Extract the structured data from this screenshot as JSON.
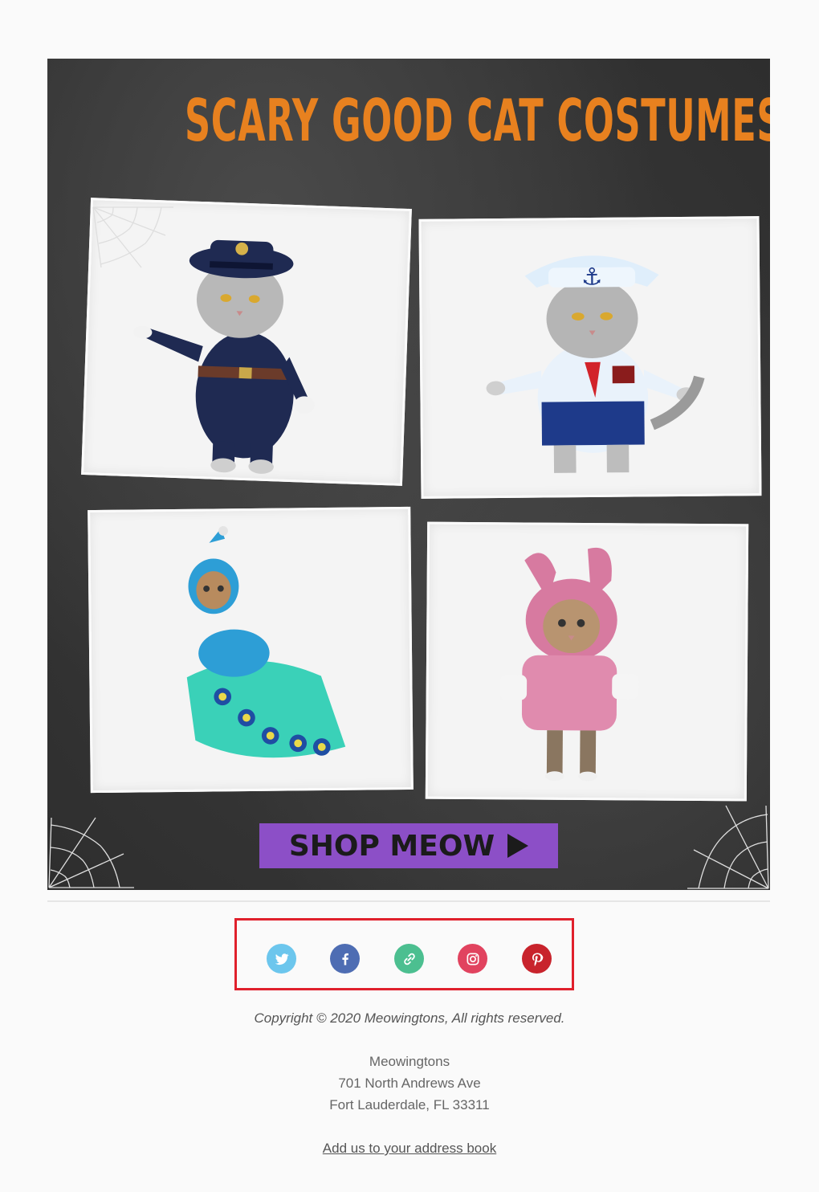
{
  "hero": {
    "title": "SCARY GOOD CAT COSTUMES",
    "shop_button": "SHOP MEOW",
    "colors": {
      "title": "#e8811f",
      "button": "#8c4fc7",
      "background": "#333333"
    },
    "photos": [
      "police-cat",
      "sailor-cat",
      "peacock-cat",
      "bunny-cat"
    ]
  },
  "social": {
    "icons": [
      "twitter-icon",
      "facebook-icon",
      "link-icon",
      "instagram-icon",
      "pinterest-icon"
    ],
    "colors": {
      "twitter": "#6cc6ed",
      "facebook": "#4e6db3",
      "link": "#4cbf90",
      "instagram": "#e1435f",
      "pinterest": "#c8232c"
    }
  },
  "footer": {
    "copyright": "Copyright © 2020 Meowingtons, All rights reserved.",
    "company": "Meowingtons",
    "street": "701 North Andrews Ave",
    "city": "Fort Lauderdale, FL 33311",
    "address_book_link": "Add us to your address book"
  }
}
